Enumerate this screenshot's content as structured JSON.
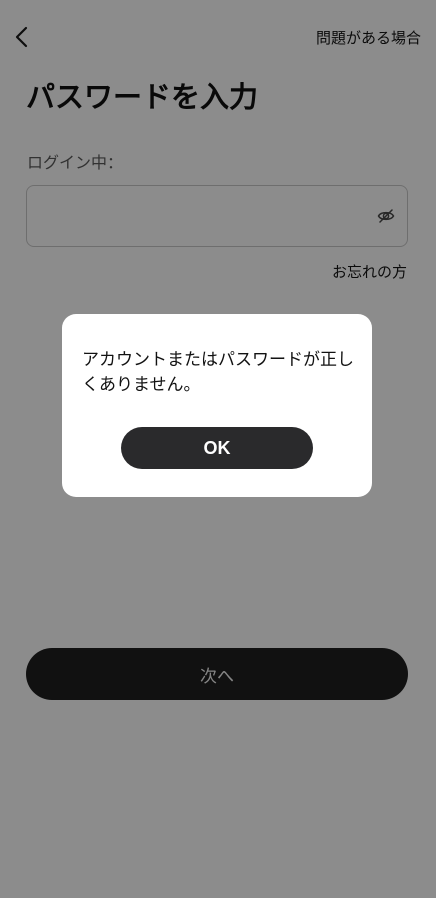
{
  "header": {
    "back_icon": "chevron-left-icon",
    "help_link": "問題がある場合"
  },
  "main": {
    "title": "パスワードを入力",
    "login_label": "ログイン中：",
    "password": {
      "value": "",
      "placeholder": "",
      "toggle_icon": "eye-off-icon"
    },
    "forgot_link": "お忘れの方",
    "next_button": "次へ"
  },
  "dialog": {
    "message": "アカウントまたはパスワードが正しくありません。",
    "ok_button": "OK"
  },
  "colors": {
    "overlay": "#8a8a8a",
    "primary_button": "#1f1f1f",
    "dialog_button": "#2a2a2c"
  }
}
